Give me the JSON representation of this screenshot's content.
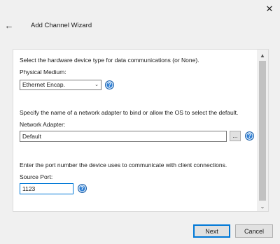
{
  "window": {
    "title": "Add Channel Wizard",
    "close_glyph": "✕",
    "back_glyph": "←"
  },
  "physical_medium": {
    "description": "Select the hardware device type for data communications (or None).",
    "label": "Physical Medium:",
    "value": "Ethernet Encap.",
    "arrow": "⌄"
  },
  "network_adapter": {
    "description": "Specify the name of a network adapter to bind or allow the OS to select the default.",
    "label": "Network Adapter:",
    "value": "Default",
    "browse_label": "..."
  },
  "source_port": {
    "description": "Enter the port number the device uses to communicate with client connections.",
    "label": "Source Port:",
    "value": "1123"
  },
  "help_glyph": "?",
  "scrollbar": {
    "up": "▲",
    "down": "⌄"
  },
  "buttons": {
    "next": "Next",
    "cancel": "Cancel"
  },
  "colors": {
    "accent": "#0078d7",
    "help_icon": "#2f7fd4"
  }
}
